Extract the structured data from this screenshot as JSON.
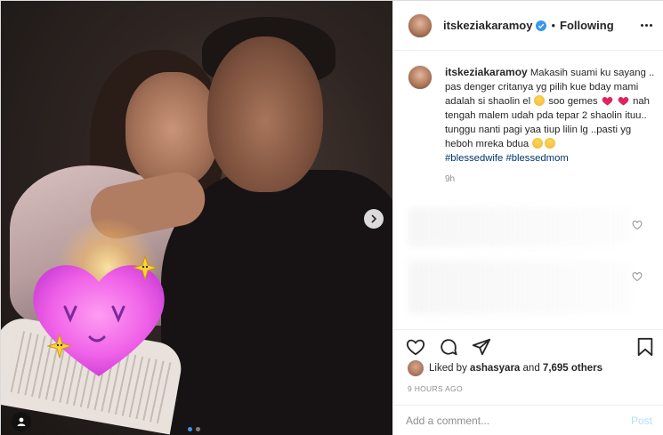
{
  "post": {
    "username": "itskeziakaramoy",
    "bullet": "•",
    "follow_status": "Following",
    "carousel": {
      "current_index": 0,
      "total": 2
    }
  },
  "caption": {
    "username": "itskeziakaramoy",
    "line1": "Makasih suami ku sayang .. pas denger critanya yg pilih kue bday mami adalah si shaolin el",
    "line2": "soo gemes",
    "line3": "nah tengah malem udah pda tepar 2 shaolin ituu.. tunggu nanti pagi yaa tiup lilin lg ..pasti yg heboh mreka bdua",
    "hashtags": "#blessedwife #blessedmom",
    "age": "9h"
  },
  "likes": {
    "liked_by_label": "Liked by",
    "liked_by_user": "ashasyara",
    "and_label": "and",
    "others_count": "7,695 others"
  },
  "post_time": "9 HOURS AGO",
  "comment": {
    "placeholder": "Add a comment...",
    "post_label": "Post"
  },
  "icons": {
    "verified": "verified-badge-icon",
    "more": "more-options-icon",
    "like": "heart-outline-icon",
    "comment": "comment-icon",
    "share": "paper-plane-icon",
    "save": "bookmark-icon",
    "next": "chevron-right-icon",
    "tag": "user-tag-icon"
  },
  "colors": {
    "verified": "#3897f0",
    "hashtag": "#00376b",
    "post_disabled": "#b2dffc",
    "heart_emoji": "#e0245e"
  }
}
